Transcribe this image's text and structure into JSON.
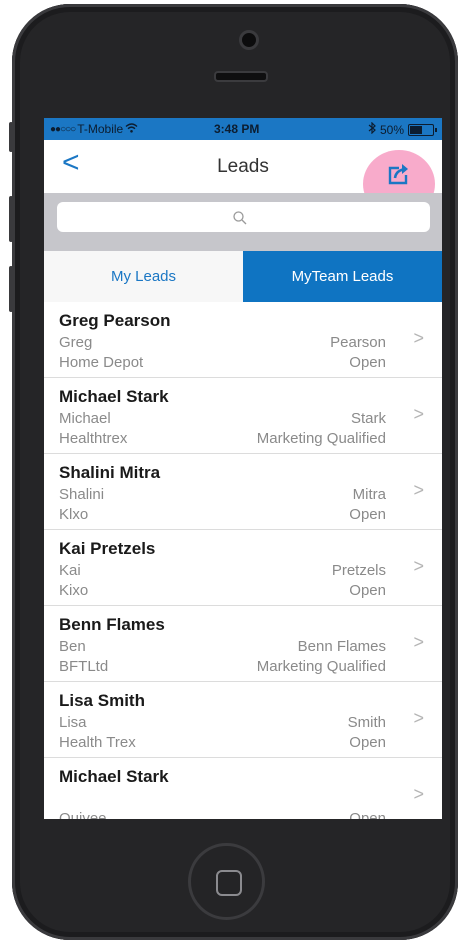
{
  "status_bar": {
    "carrier": "T-Mobile",
    "time": "3:48 PM",
    "battery_percent": "50%",
    "signal_icon": "signal-dots-icon",
    "wifi_icon": "wifi-icon",
    "bluetooth_icon": "bluetooth-icon"
  },
  "navbar": {
    "back_label": "<",
    "title": "Leads",
    "share_icon": "share-icon"
  },
  "search": {
    "placeholder": "",
    "icon": "search-icon"
  },
  "tabs": [
    {
      "label": "My Leads",
      "active": false
    },
    {
      "label": "MyTeam Leads",
      "active": true
    }
  ],
  "leads": [
    {
      "name": "Greg Pearson",
      "first": "Greg",
      "last": "Pearson",
      "company": "Home Depot",
      "status": "Open"
    },
    {
      "name": "Michael  Stark",
      "first": "Michael",
      "last": "Stark",
      "company": "Healthtrex",
      "status": "Marketing Qualified"
    },
    {
      "name": "Shalini Mitra",
      "first": "Shalini",
      "last": "Mitra",
      "company": "Klxo",
      "status": "Open"
    },
    {
      "name": "Kai Pretzels",
      "first": "Kai",
      "last": "Pretzels",
      "company": "Kixo",
      "status": "Open"
    },
    {
      "name": "Benn Flames",
      "first": "Ben",
      "last": "Benn Flames",
      "company": "BFTLtd",
      "status": "Marketing Qualified"
    },
    {
      "name": "Lisa  Smith",
      "first": "Lisa",
      "last": "Smith",
      "company": "Health Trex",
      "status": "Open"
    },
    {
      "name": "Michael Stark",
      "first": "",
      "last": "",
      "company": "Quivee",
      "status": "Open"
    }
  ],
  "chevron": ">",
  "colors": {
    "accent": "#1b77c4",
    "highlight": "#f694bc",
    "phone_body": "#252527"
  }
}
